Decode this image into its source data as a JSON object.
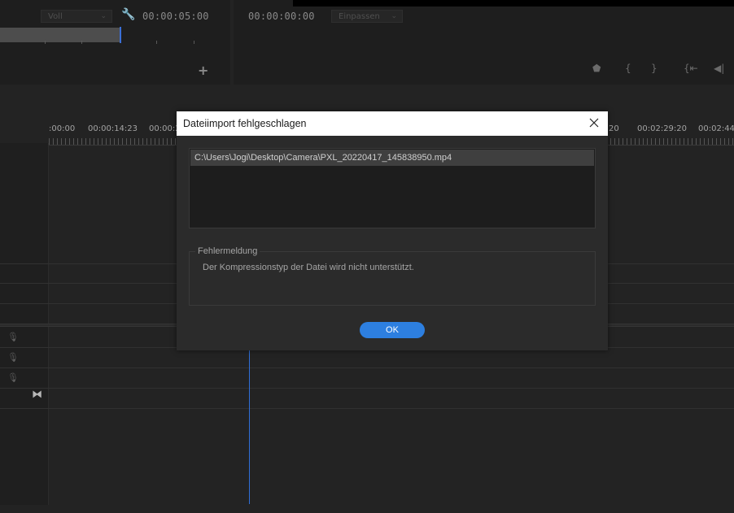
{
  "source_monitor": {
    "quality_dropdown": "Voll",
    "timecode": "00:00:05:00",
    "add_icon": "+"
  },
  "program_monitor": {
    "timecode": "00:00:00:00",
    "fit_dropdown": "Einpassen"
  },
  "timeline": {
    "ruler_labels": [
      ":00:00",
      "00:00:14:23",
      "00:00:2",
      "20",
      "00:02:29:20",
      "00:02:44:"
    ]
  },
  "dialog": {
    "title": "Dateiimport fehlgeschlagen",
    "file_path": "C:\\Users\\Jogi\\Desktop\\Camera\\PXL_20220417_145838950.mp4",
    "error_group_label": "Fehlermeldung",
    "error_message": "Der Kompressionstyp der Datei wird nicht unterstützt.",
    "ok_label": "OK"
  },
  "colors": {
    "accent": "#2d7fe0",
    "playhead": "#2f6fd8"
  }
}
